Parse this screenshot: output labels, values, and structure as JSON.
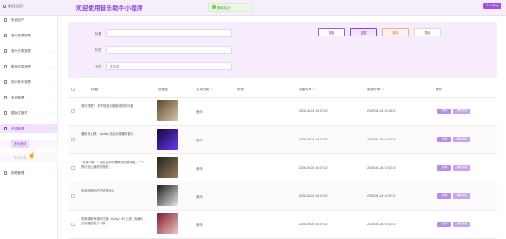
{
  "header": {
    "home_label": "前往首页",
    "app_title": "欢迎使用音乐助手小程序",
    "toast_text": "删除成功!",
    "user_center_label": "个人中心"
  },
  "sidebar": {
    "items": [
      {
        "label": "系统用户"
      },
      {
        "label": "音乐资源管理"
      },
      {
        "label": "音乐分类管理"
      },
      {
        "label": "歌单信息管理"
      },
      {
        "label": "用户音乐管理"
      },
      {
        "label": "系统管理"
      },
      {
        "label": "模板位管理"
      },
      {
        "label": "资源管理"
      },
      {
        "label": "视频管理"
      }
    ],
    "submenu": [
      "音乐资讯",
      "资讯分类"
    ]
  },
  "search": {
    "title_label": "标题",
    "tag_label": "标签",
    "category_label": "分类",
    "category_placeholder": "请选择",
    "search_button": "搜索",
    "reset_button": "重置",
    "delete_button": "删除",
    "export_button": "导出"
  },
  "table": {
    "headers": {
      "title": "标题",
      "cover": "封面图",
      "category": "文章分类",
      "tags": "标签",
      "created": "创建时间",
      "updated": "更新时间",
      "actions": "操作"
    },
    "rows": [
      {
        "title": "音乐学堂？ 你不知道已被取缔流的乐器",
        "category": "音乐",
        "created": "2025-04-24 10:02:22",
        "updated": "2025-04-24 16:18:19",
        "edit": "详情",
        "del": "删除详情",
        "thumb_colors": [
          "#5c4a2c",
          "#d6c9a8"
        ]
      },
      {
        "title": "潮听风上榜，Spotify 推出对现潮听音乐",
        "category": "音乐",
        "created": "2025-04-24 10:02:22",
        "updated": "2025-04-24 10:02:22",
        "edit": "详情",
        "del": "删除详情",
        "thumb_colors": [
          "#12073a",
          "#6a39f0"
        ]
      },
      {
        "title": "\"非常不爽\" ！高出名的乐器教你的跳来跳，一个很行业让我改的规范",
        "category": "音乐",
        "created": "2025-04-24 10:02:22",
        "updated": "2025-04-24 10:02:22",
        "edit": "详情",
        "del": "删除详情",
        "thumb_colors": [
          "#222222",
          "#9a7d5a"
        ]
      },
      {
        "title": "连享听音乐的好处是什么",
        "category": "音乐",
        "created": "2025-04-24 10:02:22",
        "updated": "2025-04-24 10:02:22",
        "edit": "详情",
        "del": "删除详情",
        "thumb_colors": [
          "#1a1a1a",
          "#e9e9e9"
        ]
      },
      {
        "title": "完美调频专辑为打造《Solly》MV上线，而满乐天则播放说什么歌",
        "category": "音乐",
        "created": "2025-04-24 10:02:22",
        "updated": "2025-04-24 10:02:22",
        "edit": "详情",
        "del": "删除详情",
        "thumb_colors": [
          "#7a1f2b",
          "#f2c9c4"
        ]
      }
    ]
  }
}
